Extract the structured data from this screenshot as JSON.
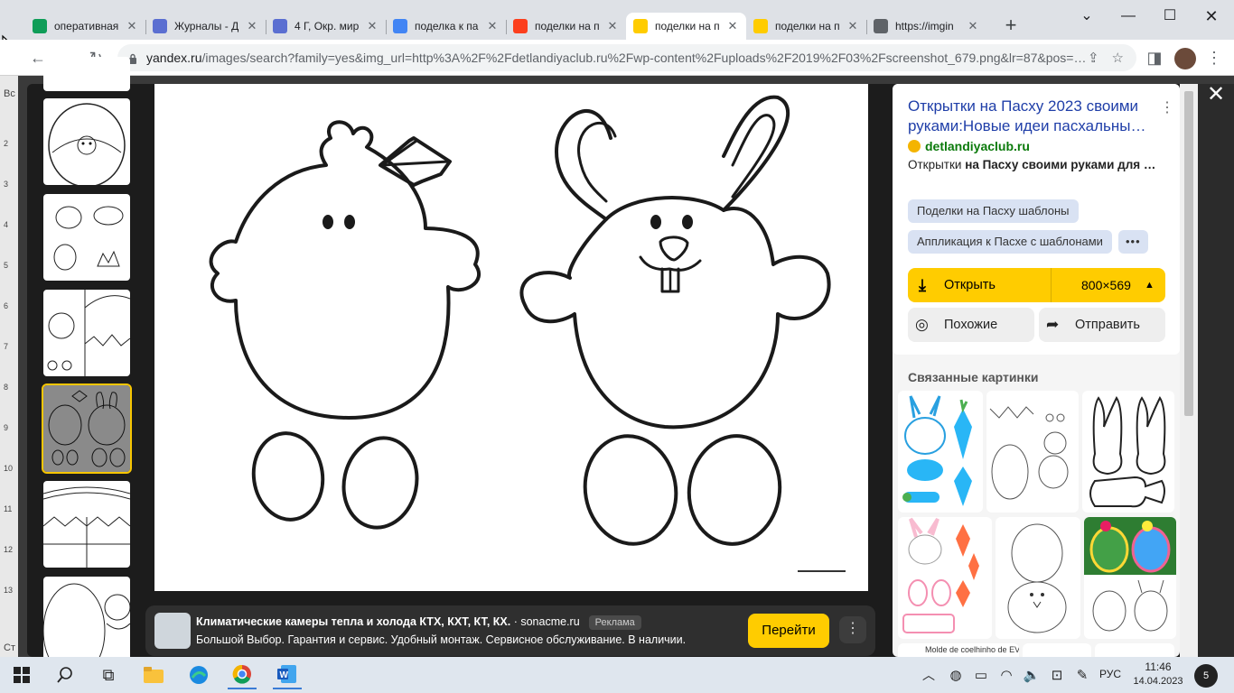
{
  "browser": {
    "tabs": [
      {
        "title": "оперативная",
        "favicon": "sheets-icon",
        "color": "#0f9d58",
        "active": false
      },
      {
        "title": "Журналы - Д",
        "favicon": "journal-icon",
        "color": "#5b6fd1",
        "active": false
      },
      {
        "title": "4 Г, Окр. мир",
        "favicon": "journal-icon",
        "color": "#5b6fd1",
        "active": false
      },
      {
        "title": "поделка к па",
        "favicon": "google-icon",
        "color": "#4285f4",
        "active": false
      },
      {
        "title": "поделки на п",
        "favicon": "yandex-icon",
        "color": "#fc3f1d",
        "active": false
      },
      {
        "title": "поделки на п",
        "favicon": "yandex-images-icon",
        "color": "#ffcc00",
        "active": true
      },
      {
        "title": "поделки на п",
        "favicon": "yandex-images-icon",
        "color": "#ffcc00",
        "active": false
      },
      {
        "title": "https://imgin",
        "favicon": "globe-icon",
        "color": "#5f6368",
        "active": false
      }
    ],
    "url_host": "yandex.ru",
    "url_path": "/images/search?family=yes&img_url=http%3A%2F%2Fdetlandiyaclub.ru%2Fwp-content%2Fuploads%2F2019%2F03%2Fscreenshot_679.png&lr=87&pos=…"
  },
  "left_strip": {
    "text_top": "Вс",
    "text_bottom": "Ст",
    "ruler": [
      "2",
      "3",
      "4",
      "5",
      "6",
      "7",
      "8",
      "9",
      "10",
      "11",
      "12",
      "13"
    ]
  },
  "panel": {
    "title": "Открытки на Пасху 2023 своими руками:Новые идеи пасхальны…",
    "site": "detlandiyaclub.ru",
    "desc_plain": "Открытки ",
    "desc_bold": "на Пасху своими руками для …",
    "chips": [
      "Поделки на Пасху шаблоны",
      "Аппликация к Пасхе с шаблонами",
      "•••"
    ],
    "open_label": "Открыть",
    "size": "800×569",
    "similar_label": "Похожие",
    "share_label": "Отправить",
    "related_header": "Связанные картинки",
    "related_caption": "Molde de coelhinho de EVA"
  },
  "ad": {
    "title": "Климатические камеры тепла и холода КТХ, КХТ, КТ, КХ.",
    "domain": " · sonacme.ru",
    "badge": "Реклама",
    "text": "Большой Выбор. Гарантия и сервис. Удобный монтаж. Сервисное обслуживание. В наличии.",
    "go_label": "Перейти"
  },
  "taskbar": {
    "lang": "РУС",
    "time": "11:46",
    "date": "14.04.2023",
    "notifications": "5"
  },
  "colors": {
    "accent": "#ffcc00",
    "link": "#1f3ea8",
    "site": "#0b7a0b"
  }
}
